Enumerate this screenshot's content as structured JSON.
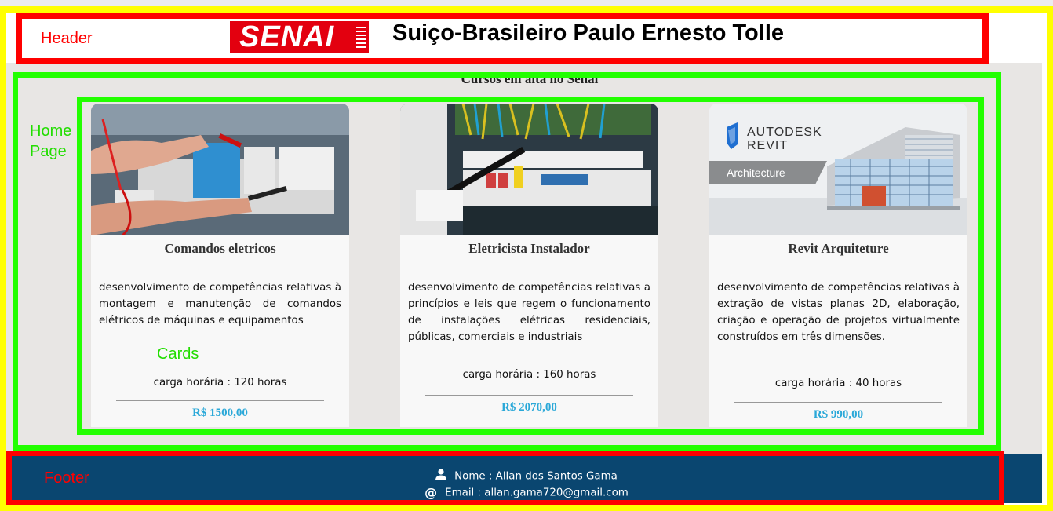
{
  "annotations": {
    "header": "Header",
    "home_line1": "Home",
    "home_line2": "Page",
    "cards": "Cards",
    "footer": "Footer"
  },
  "header": {
    "logo_text": "SENAI",
    "title": "Suiço-Brasileiro Paulo Ernesto Tolle"
  },
  "main": {
    "section_title": "Cursos em alta no Senai"
  },
  "cards": [
    {
      "image": "electrical-panel-hands-photo",
      "title": "Comandos eletricos",
      "description": "desenvolvimento de competências relativas à montagem e manutenção de comandos elétricos de máquinas e equipamentos",
      "hours": "carga horária : 120 horas",
      "price": "R$ 1500,00"
    },
    {
      "image": "circuit-breaker-screwdriver-photo",
      "title": "Eletricista Instalador",
      "description": "desenvolvimento de competências relativas a princípios e leis que regem o funcionamento de instalações elétricas residenciais, públicas, comerciais e industriais",
      "hours": "carga horária : 160 horas",
      "price": "R$ 2070,00"
    },
    {
      "image": "autodesk-revit-architecture-banner",
      "title": "Revit Arquiteture",
      "description": "desenvolvimento de competências relativas à extração de vistas planas 2D, elaboração, criação e operação de projetos virtualmente construídos em três dimensões.",
      "hours": "carga horária : 40 horas",
      "price": "R$ 990,00",
      "banner": {
        "brand": "AUTODESK",
        "product": "REVIT",
        "edition": "Architecture"
      }
    }
  ],
  "footer": {
    "name": "Nome : Allan dos Santos Gama",
    "email": "Email : allan.gama720@gmail.com"
  },
  "colors": {
    "annotation_red": "#ff0000",
    "annotation_green": "#22ff00",
    "outer_frame": "#ffff00",
    "footer_bg": "#0a4670",
    "price": "#2aa8d8",
    "senai_red": "#e3000f"
  }
}
